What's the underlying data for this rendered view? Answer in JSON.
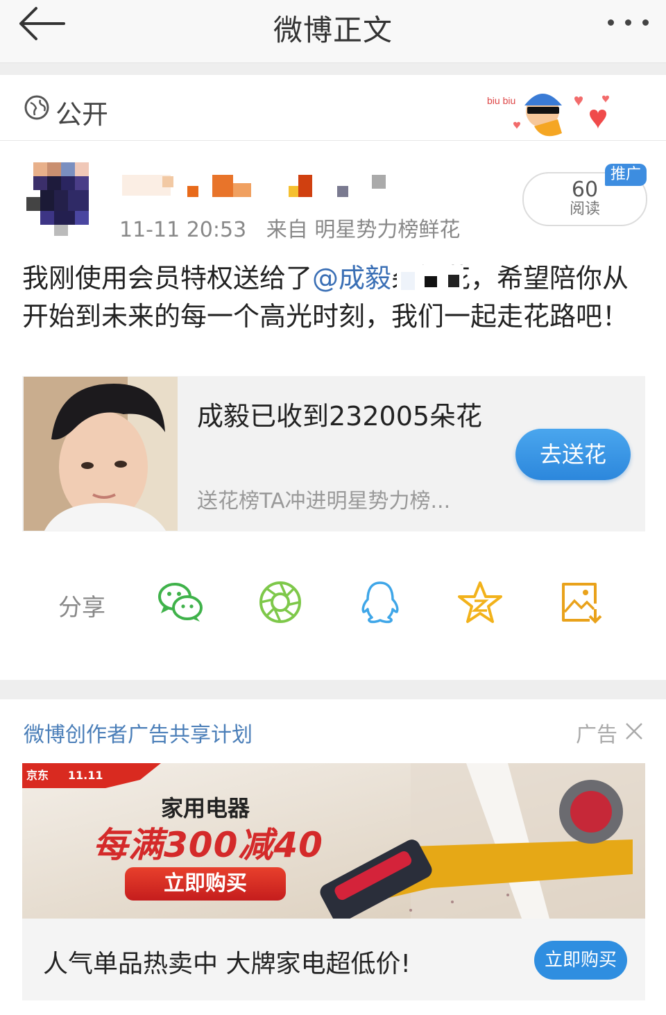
{
  "nav": {
    "title": "微博正文"
  },
  "visibility": {
    "label": "公开"
  },
  "post": {
    "time": "11-11 20:53",
    "source": "来自 明星势力榜鲜花",
    "body_pre": "我刚使用会员特权送给了",
    "mention": "@成毅",
    "body_post": "朵鲜花，希望陪你从开始到未来的每一个高光时刻，我们一起走花路吧！",
    "read_count": "60",
    "read_label": "阅读",
    "promo_tag": "推广"
  },
  "flower_card": {
    "title": "成毅已收到232005朵花",
    "subtitle": "送花榜TA冲进明星势力榜...",
    "button": "去送花"
  },
  "share": {
    "label": "分享",
    "targets": [
      "wechat-icon",
      "moments-icon",
      "qq-icon",
      "qzone-icon",
      "save-image-icon"
    ]
  },
  "ad": {
    "header": "微博创作者广告共享计划",
    "label": "广告",
    "banner_line1": "家用电器",
    "banner_line2": "每满300减40",
    "banner_button": "立即购买",
    "banner_brand": "京东",
    "banner_event": "11.11",
    "caption": "人气单品热卖中 大牌家电超低价!",
    "button": "立即购买"
  },
  "colors": {
    "link": "#3a6fb5",
    "button_blue": "#2f8ee0",
    "promo_red": "#d42a2a"
  }
}
